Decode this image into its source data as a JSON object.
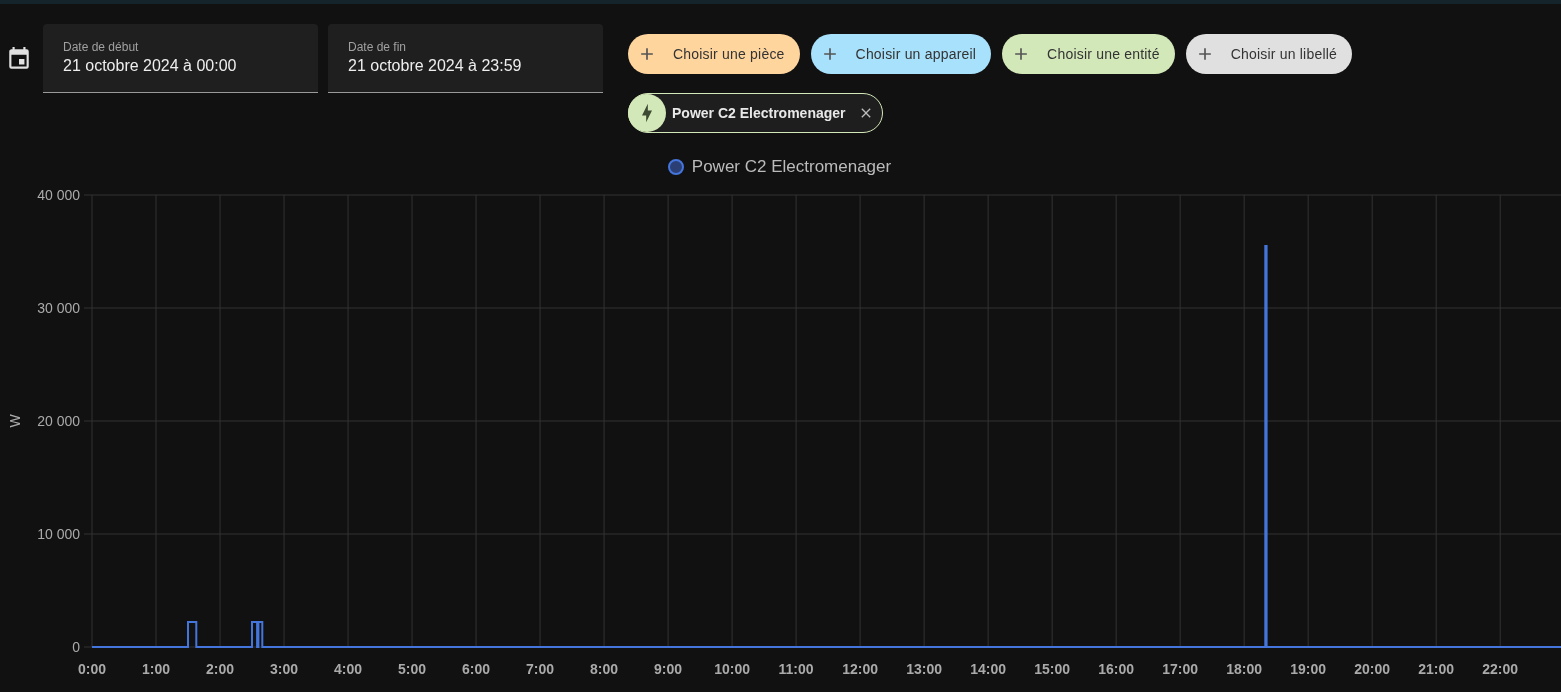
{
  "date_range": {
    "start": {
      "label": "Date de début",
      "value": "21 octobre 2024 à 00:00"
    },
    "end": {
      "label": "Date de fin",
      "value": "21 octobre 2024 à 23:59"
    }
  },
  "pickers": [
    {
      "label": "Choisir une pièce",
      "color": "#ffd59e"
    },
    {
      "label": "Choisir un appareil",
      "color": "#a8e1fb"
    },
    {
      "label": "Choisir une entité",
      "color": "#d3e8b8"
    },
    {
      "label": "Choisir un libellé",
      "color": "#e0e0e0"
    }
  ],
  "selected_entities": [
    {
      "label": "Power C2 Electromenager",
      "color": "#d3e8b8"
    }
  ],
  "chart": {
    "chart_data": {
      "type": "line",
      "ylabel": "W",
      "x": [
        0,
        1.5,
        1.5,
        1.63,
        1.63,
        2.5,
        2.5,
        2.58,
        2.58,
        2.6,
        2.6,
        2.66,
        2.66,
        18.33,
        18.33,
        18.35,
        18.35,
        22.95
      ],
      "series": [
        {
          "name": "Power C2 Electromenager",
          "color": "#4475dc",
          "values": [
            0,
            0,
            2200,
            2200,
            0,
            0,
            2200,
            2200,
            0,
            0,
            2200,
            2200,
            0,
            0,
            35500,
            35500,
            0,
            0
          ]
        }
      ],
      "grid": true,
      "xlim": [
        0,
        22.95
      ],
      "ylim": [
        0,
        40000
      ],
      "xticks": [
        {
          "value": 0,
          "label": "0:00"
        },
        {
          "value": 1,
          "label": "1:00"
        },
        {
          "value": 2,
          "label": "2:00"
        },
        {
          "value": 3,
          "label": "3:00"
        },
        {
          "value": 4,
          "label": "4:00"
        },
        {
          "value": 5,
          "label": "5:00"
        },
        {
          "value": 6,
          "label": "6:00"
        },
        {
          "value": 7,
          "label": "7:00"
        },
        {
          "value": 8,
          "label": "8:00"
        },
        {
          "value": 9,
          "label": "9:00"
        },
        {
          "value": 10,
          "label": "10:00"
        },
        {
          "value": 11,
          "label": "11:00"
        },
        {
          "value": 12,
          "label": "12:00"
        },
        {
          "value": 13,
          "label": "13:00"
        },
        {
          "value": 14,
          "label": "14:00"
        },
        {
          "value": 15,
          "label": "15:00"
        },
        {
          "value": 16,
          "label": "16:00"
        },
        {
          "value": 17,
          "label": "17:00"
        },
        {
          "value": 18,
          "label": "18:00"
        },
        {
          "value": 19,
          "label": "19:00"
        },
        {
          "value": 20,
          "label": "20:00"
        },
        {
          "value": 21,
          "label": "21:00"
        },
        {
          "value": 22,
          "label": "22:00"
        }
      ],
      "yticks": [
        {
          "value": 0,
          "label": "0"
        },
        {
          "value": 10000,
          "label": "10 000"
        },
        {
          "value": 20000,
          "label": "20 000"
        },
        {
          "value": 30000,
          "label": "30 000"
        },
        {
          "value": 40000,
          "label": "40 000"
        }
      ]
    }
  }
}
